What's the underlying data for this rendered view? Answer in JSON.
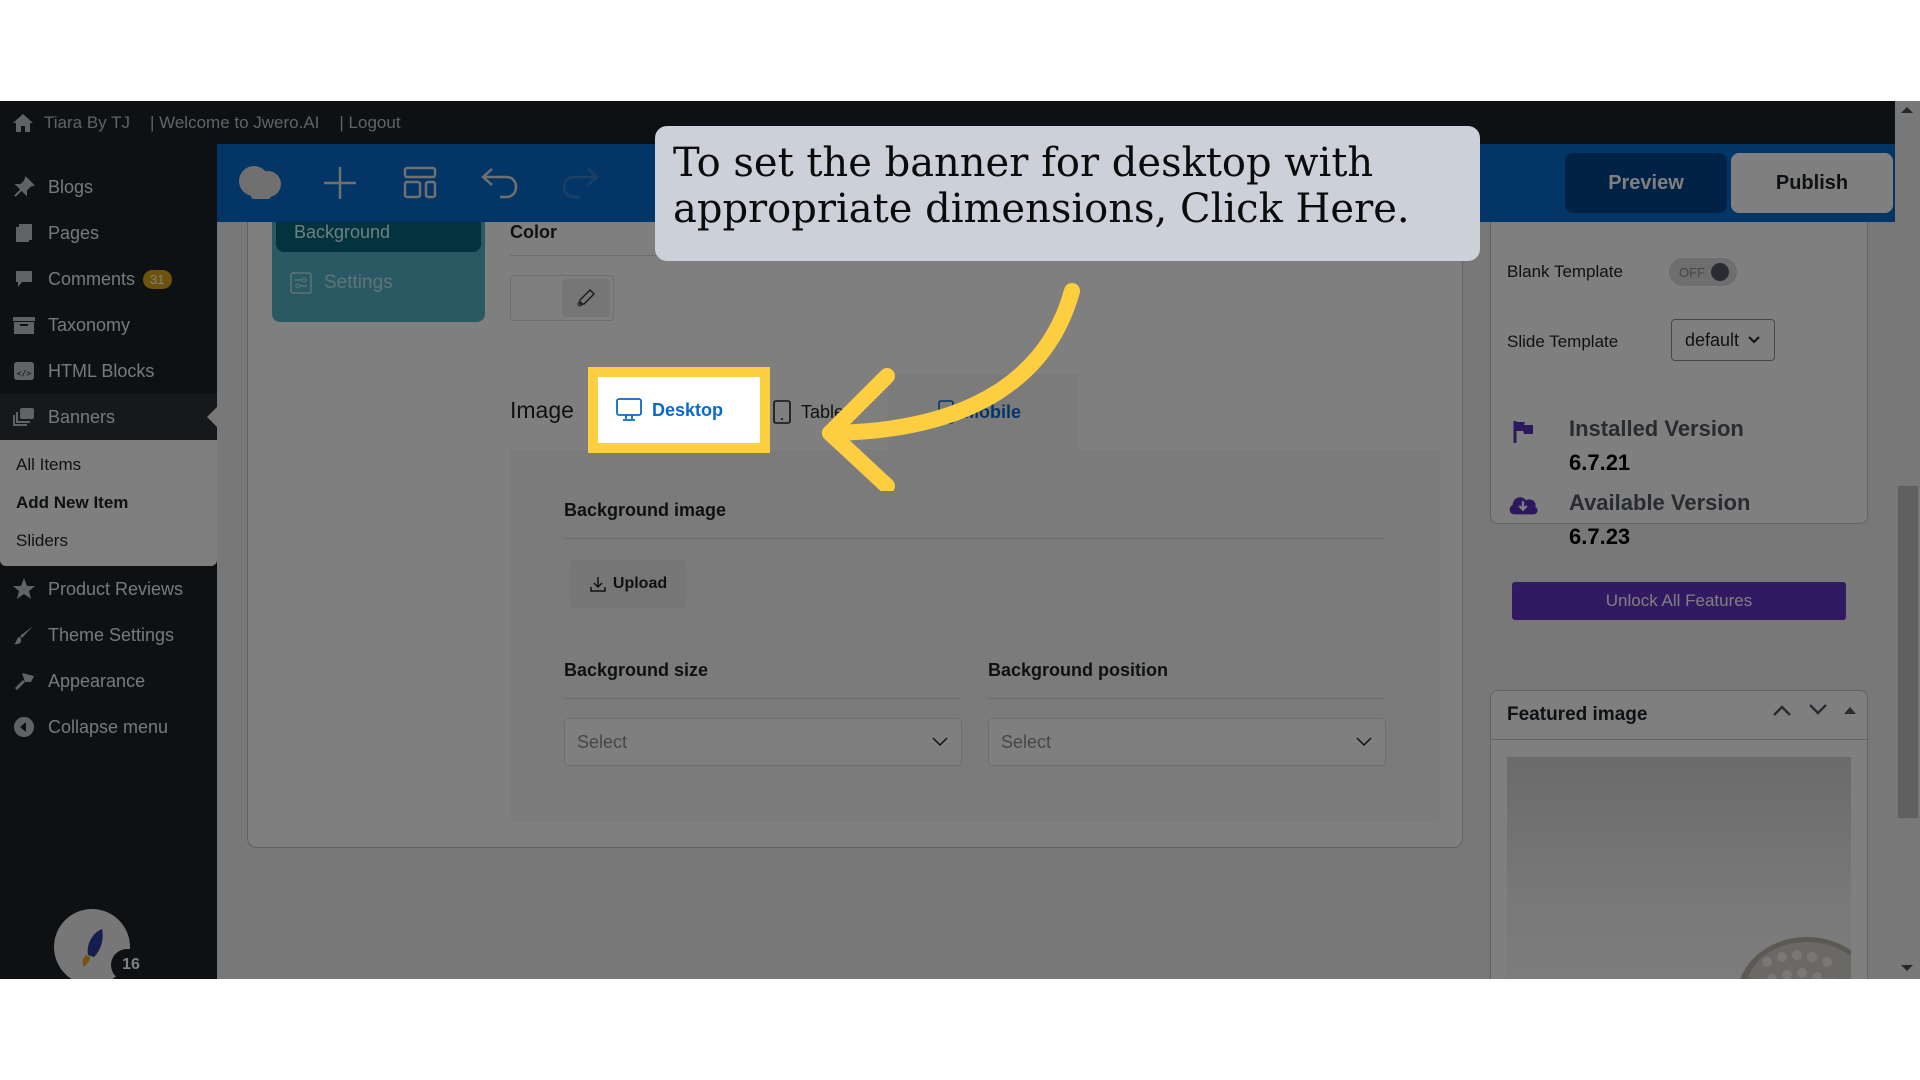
{
  "admin_bar": {
    "site_name": "Tiara By TJ",
    "welcome": "| Welcome to Jwero.AI",
    "logout": "| Logout"
  },
  "sidebar": {
    "items": [
      {
        "label": "Blogs",
        "icon": "pin-icon"
      },
      {
        "label": "Pages",
        "icon": "pages-icon"
      },
      {
        "label": "Comments",
        "icon": "comment-icon",
        "badge": "31"
      },
      {
        "label": "Taxonomy",
        "icon": "archive-icon"
      },
      {
        "label": "HTML Blocks",
        "icon": "code-block-icon"
      },
      {
        "label": "Banners",
        "icon": "banners-icon",
        "active": true
      }
    ],
    "submenu": [
      {
        "label": "All Items"
      },
      {
        "label": "Add New Item",
        "current": true
      },
      {
        "label": "Sliders"
      }
    ],
    "items_after": [
      {
        "label": "Product Reviews",
        "icon": "star-icon"
      },
      {
        "label": "Theme Settings",
        "icon": "brush-icon"
      },
      {
        "label": "Appearance",
        "icon": "paintbrush-icon"
      },
      {
        "label": "Collapse menu",
        "icon": "collapse-icon"
      }
    ],
    "rocket_count": "16"
  },
  "toolbar": {
    "icons": [
      "logo-icon",
      "add-icon",
      "layout-icon",
      "undo-icon",
      "redo-icon"
    ],
    "preview_label": "Preview",
    "publish_label": "Publish"
  },
  "editor": {
    "side_tabs": {
      "background": "Background",
      "settings": "Settings"
    },
    "color_label": "Color",
    "image_label": "Image",
    "device_tabs": {
      "desktop": "Desktop",
      "tablet": "Tablet",
      "mobile": "Mobile"
    },
    "background_image_label": "Background image",
    "upload_label": "Upload",
    "background_size_label": "Background size",
    "background_size_placeholder": "Select",
    "background_position_label": "Background position",
    "background_position_placeholder": "Select"
  },
  "right_panel": {
    "blank_template_label": "Blank Template",
    "blank_template_toggle": "OFF",
    "slide_template_label": "Slide Template",
    "slide_template_value": "default",
    "installed_version_label": "Installed Version",
    "installed_version": "6.7.21",
    "available_version_label": "Available Version",
    "available_version": "6.7.23",
    "unlock_label": "Unlock All Features",
    "featured_image_label": "Featured image"
  },
  "callout": {
    "text_line1": "To set the banner for desktop with",
    "text_line2": "appropriate dimensions, Click Here."
  },
  "colors": {
    "highlight": "#fdcf40",
    "toolbar": "#066acc",
    "admin_bar": "#1d2327",
    "unlock": "#6535c4"
  }
}
